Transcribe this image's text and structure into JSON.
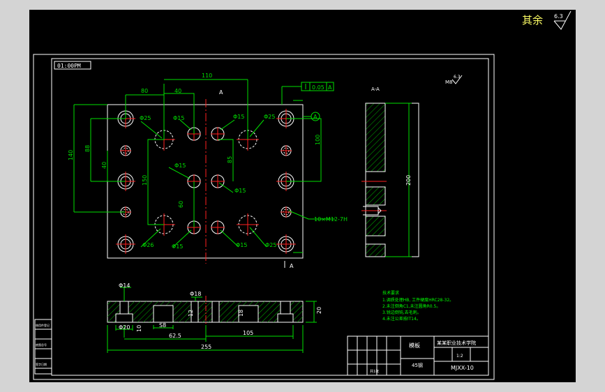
{
  "corner_note": {
    "text": "其余",
    "roughness": "6.3"
  },
  "scale_box": "01:00PM",
  "section_label": "A",
  "section_view_label": "A-A",
  "roughness_note": {
    "prefix": "M8",
    "value": "6.3"
  },
  "dims": {
    "d110": "110",
    "d80": "80",
    "d40_top": "40",
    "d140": "140",
    "d88": "88",
    "d40_left": "40",
    "d100": "100",
    "d150": "150",
    "d60": "60",
    "d85": "85",
    "d200": "200",
    "phi25_a": "Φ25",
    "phi15_a": "Φ15",
    "phi15_b": "Φ15",
    "phi25_b": "Φ25",
    "phi15_c": "Φ15",
    "phi15_d": "Φ15",
    "phi25_c": "Φ26",
    "phi15_e": "Φ15",
    "phi15_f": "Φ15",
    "phi25_d": "Φ25",
    "thread": "10×M12-7H",
    "tolerance_value": "0.05",
    "tolerance_datum": "A",
    "datum": "A",
    "bottom_phi14": "Φ14",
    "bottom_phi18": "Φ18",
    "bottom_phi20": "Φ20",
    "bottom_10": "10",
    "bottom_s8": "S8",
    "bottom_62_5": "62.5",
    "bottom_105": "105",
    "bottom_255": "255",
    "bottom_20": "20",
    "bottom_a": "12",
    "bottom_b": "18"
  },
  "tech_notes": {
    "title": "技术要求",
    "lines": [
      "1.调质处理HB, 工件硬度HRC28-32。",
      "2.未注倒角C1,未注圆角R0.5。",
      "3.锐边倒钝,去毛刺。",
      "4.未注公差按IT14。"
    ]
  },
  "title_block": {
    "part_name": "模板",
    "material": "45钢",
    "school": "某某职业技术学院",
    "drawing_no": "MJXX-10",
    "scale": "1:2",
    "sheet": "共1张"
  },
  "left_block": [
    "借用件登记",
    "",
    "底图总号",
    "",
    "签字日期"
  ],
  "colors": {
    "border": "#ffffff",
    "part": "#ffffff",
    "centerline": "#ff2020",
    "dimension": "#00e000",
    "hatch": "#00c000",
    "text": "#ffff66",
    "note_text": "#00ff00"
  }
}
